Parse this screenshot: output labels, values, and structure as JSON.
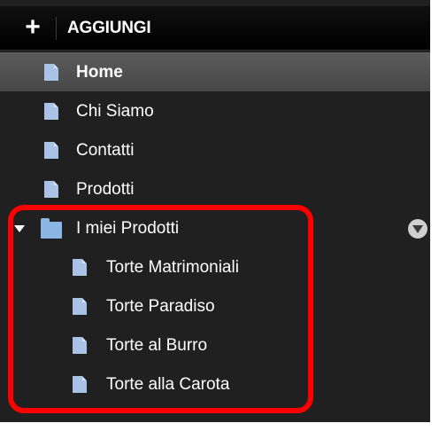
{
  "toolbar": {
    "add_icon": "plus-icon",
    "add_label": "AGGIUNGI"
  },
  "tree": {
    "pages": [
      {
        "label": "Home",
        "icon": "page-icon",
        "selected": true
      },
      {
        "label": "Chi Siamo",
        "icon": "page-icon"
      },
      {
        "label": "Contatti",
        "icon": "page-icon"
      },
      {
        "label": "Prodotti",
        "icon": "page-icon"
      }
    ],
    "folder": {
      "label": "I miei Prodotti",
      "icon": "folder-icon",
      "expanded": true,
      "children": [
        {
          "label": "Torte Matrimoniali",
          "icon": "page-icon"
        },
        {
          "label": "Torte Paradiso",
          "icon": "page-icon"
        },
        {
          "label": "Torte al Burro",
          "icon": "page-icon"
        },
        {
          "label": "Torte alla Carota",
          "icon": "page-icon"
        }
      ]
    }
  },
  "colors": {
    "panel_background": "#202020",
    "selected_row": "#555555",
    "page_icon": "#a9c2e6",
    "highlight_border": "#ff0000"
  }
}
